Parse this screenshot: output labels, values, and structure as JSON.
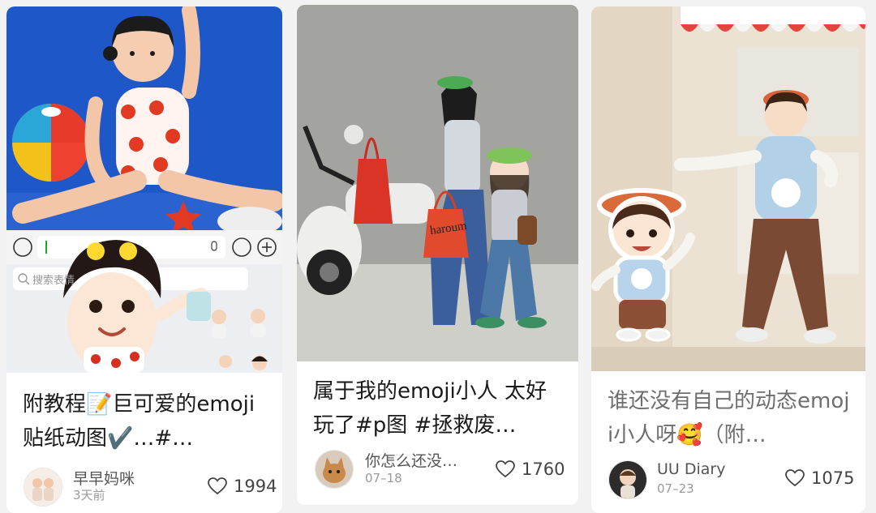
{
  "feed": {
    "posts": [
      {
        "title": "附教程📝巨可爱的emoji贴纸动图✔️…#…",
        "author": "早早妈咪",
        "date": "3天前",
        "likes": "1994",
        "search_placeholder": "搜索表情",
        "image": "girl in apple swimsuit with 3D emoji stickers and keyboard"
      },
      {
        "title": "属于我的emoji小人 太好玩了#p图 #拯救废…",
        "author": "你怎么还没…",
        "date": "07–18",
        "likes": "1760",
        "bag_text": "haroum",
        "image": "woman in green cap beside 3D emoji avatar with red tote bag"
      },
      {
        "title": "谁还没有自己的动态emoji小人呀🥰（附…",
        "author": "UU Diary",
        "date": "07–23",
        "likes": "1075",
        "image": "toddler in beret beside 3D emoji sticker"
      }
    ]
  },
  "colors": {
    "bg": "#f2f2f2",
    "card": "#ffffff",
    "text": "#1a1a1a",
    "muted": "#9a9a9a"
  }
}
